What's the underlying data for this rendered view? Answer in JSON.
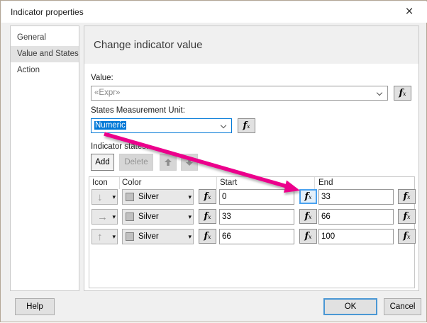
{
  "window": {
    "title": "Indicator properties"
  },
  "icons": {
    "close": "×",
    "caret": "▾",
    "fx": "fx"
  },
  "sidebar": {
    "items": [
      {
        "label": "General",
        "selected": false
      },
      {
        "label": "Value and States",
        "selected": true
      },
      {
        "label": "Action",
        "selected": false
      }
    ]
  },
  "main": {
    "heading": "Change indicator value",
    "value": {
      "label": "Value:",
      "text": "«Expr»"
    },
    "unit": {
      "label": "States Measurement Unit:",
      "text": "Numeric",
      "text_selected": true
    },
    "states": {
      "label": "Indicator states:",
      "buttons": {
        "add": "Add",
        "delete": "Delete"
      },
      "table": {
        "headers": {
          "icon": "Icon",
          "color": "Color",
          "start": "Start",
          "end": "End"
        },
        "rows": [
          {
            "icon_name": "down-arrow",
            "icon_glyph": "↓",
            "color": "Silver",
            "start": "0",
            "end": "33"
          },
          {
            "icon_name": "right-arrow",
            "icon_glyph": "→",
            "color": "Silver",
            "start": "33",
            "end": "66"
          },
          {
            "icon_name": "up-arrow",
            "icon_glyph": "↑",
            "color": "Silver",
            "start": "66",
            "end": "100"
          }
        ]
      }
    }
  },
  "footer": {
    "help": "Help",
    "ok": "OK",
    "cancel": "Cancel"
  },
  "annotation": {
    "type": "arrow",
    "color": "#ec008c",
    "points_from": "states-measurement-unit-combobox",
    "points_to": "row-1-start-expression-button"
  },
  "colors": {
    "accent": "#0078d7",
    "silver": "#c0c0c0",
    "annotation_arrow": "#ec008c"
  }
}
